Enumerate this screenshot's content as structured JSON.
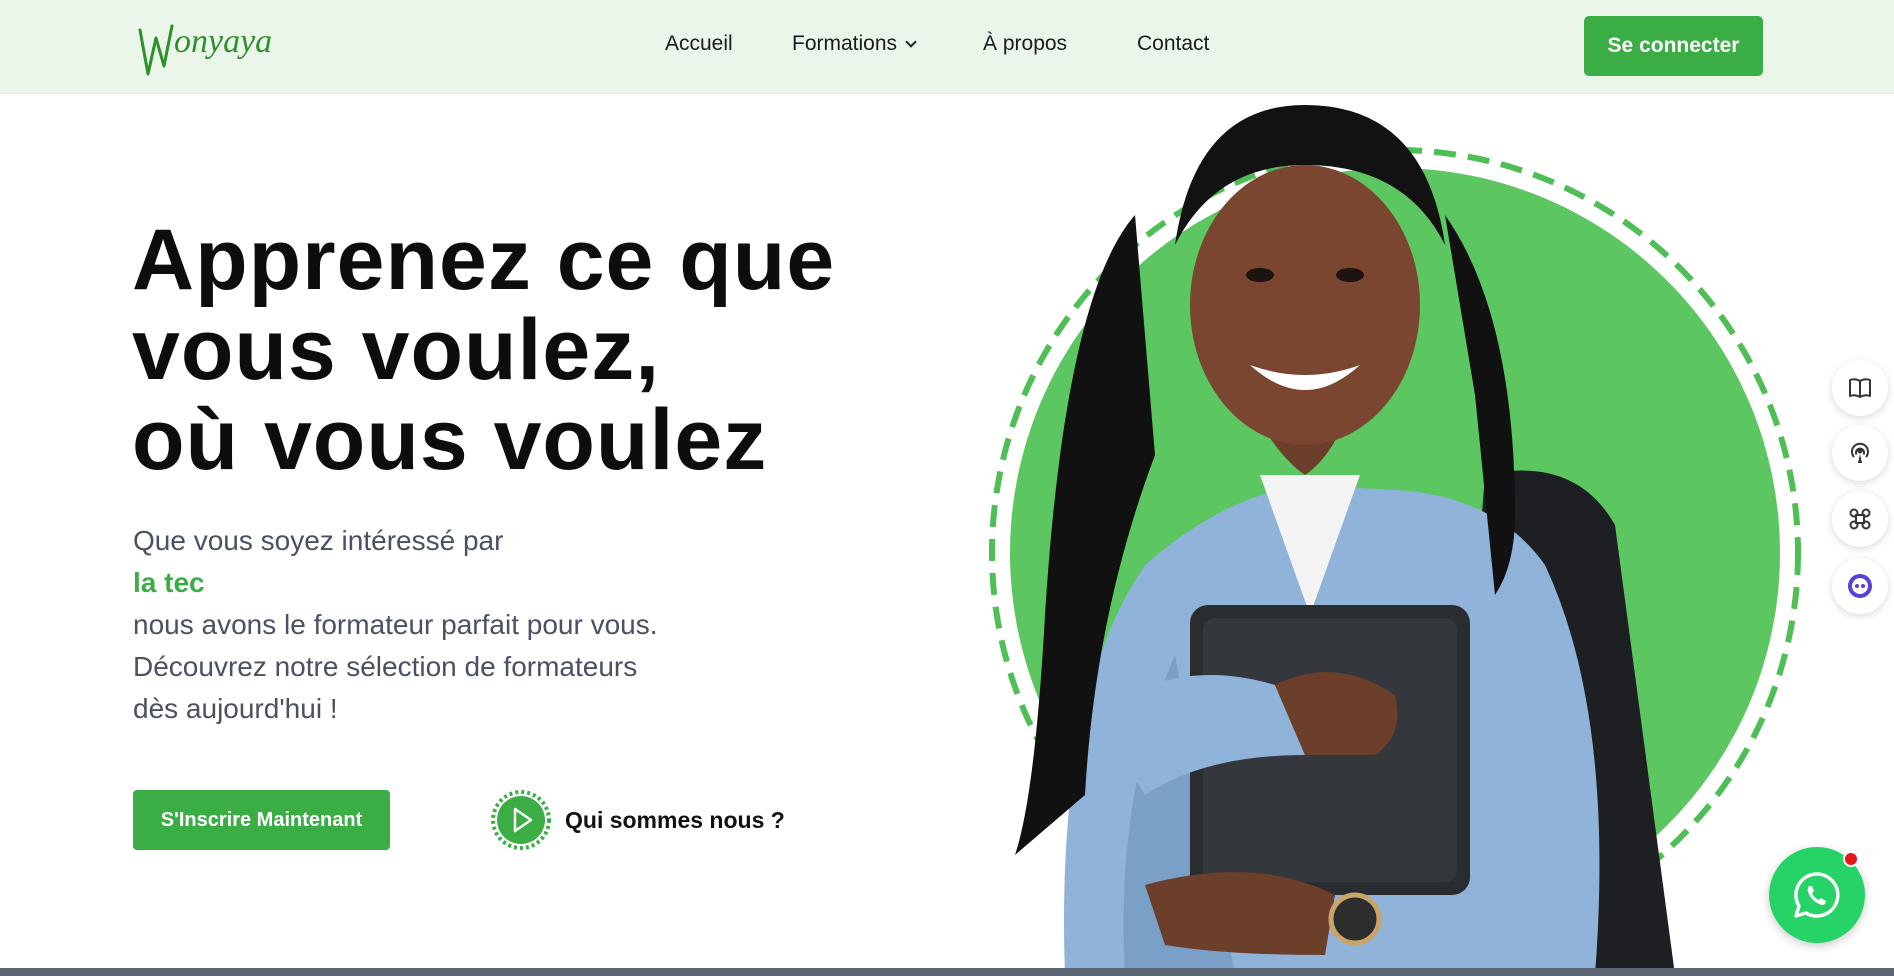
{
  "brand": {
    "logo_text": "Monyaya"
  },
  "nav": {
    "items": [
      {
        "label": "Accueil"
      },
      {
        "label": "Formations"
      },
      {
        "label": "À propos"
      },
      {
        "label": "Contact"
      }
    ],
    "login_label": "Se connecter"
  },
  "hero": {
    "title_lines": [
      "Apprenez ce que",
      "vous voulez,",
      "où vous voulez"
    ],
    "subtitle": {
      "line1": "Que vous soyez intéressé par",
      "accent": "la tec",
      "line3": "nous avons le formateur parfait pour vous.",
      "line4": "Découvrez notre sélection de formateurs",
      "line5": "dès aujourd'hui !"
    },
    "signup_label": "S'Inscrire Maintenant",
    "about_label": "Qui sommes nous ?"
  },
  "side_tools": [
    {
      "icon": "book-icon"
    },
    {
      "icon": "broadcast-icon"
    },
    {
      "icon": "command-icon"
    },
    {
      "icon": "chatbot-icon"
    }
  ],
  "colors": {
    "accent": "#3aae45",
    "header_bg": "#eaf6ea",
    "circle": "#5cc660",
    "whatsapp": "#25d366"
  }
}
